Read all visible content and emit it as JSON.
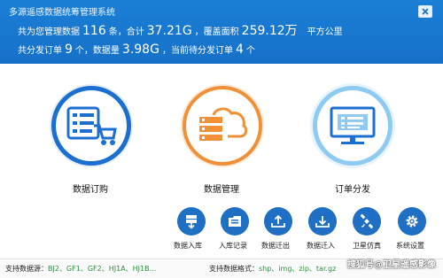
{
  "window": {
    "title": "多源遥感数据统筹管理系统"
  },
  "stats": {
    "managed_prefix": "共为您管理数据",
    "managed_count": "116",
    "managed_unit": "条，合计",
    "total_size": "37.21G",
    "coverage_label": "，覆盖面积",
    "coverage_value": "259.12万",
    "coverage_unit": "平方公里",
    "orders_prefix": "共分发订单",
    "orders_count": "9",
    "orders_mid": "个，数据量",
    "orders_size": "3.98G",
    "pending_label": "，当前待分发订单",
    "pending_count": "4",
    "pending_unit": "个"
  },
  "main_modules": [
    {
      "label": "数据订购",
      "icon": "cart-list-icon"
    },
    {
      "label": "数据管理",
      "icon": "cloud-database-icon"
    },
    {
      "label": "订单分发",
      "icon": "monitor-icon"
    }
  ],
  "tools": [
    {
      "label": "数据入库",
      "icon": "database-import-icon"
    },
    {
      "label": "入库记录",
      "icon": "folder-records-icon"
    },
    {
      "label": "数据迁出",
      "icon": "tray-upload-icon"
    },
    {
      "label": "数据迁入",
      "icon": "tray-download-icon"
    },
    {
      "label": "卫星仿真",
      "icon": "satellite-icon"
    },
    {
      "label": "系统设置",
      "icon": "gear-icon"
    }
  ],
  "footer": {
    "sources_label": "支持数据源：",
    "sources_value": "BJ2、GF1、GF2、HJ1A、HJ1B...",
    "formats_label": "支持数据格式：",
    "formats_value": "shp、img、zip、tar.gz",
    "watermark": "搜狐号@卫星遥感影像"
  },
  "colors": {
    "header_bg": "#1670c8",
    "module1_ring": "#1a6fd0",
    "module2_ring": "#f09138",
    "module3_ring": "#8fcaf2",
    "tool_bg": "#1f6fc4",
    "footer_value": "#2f8f3f"
  }
}
